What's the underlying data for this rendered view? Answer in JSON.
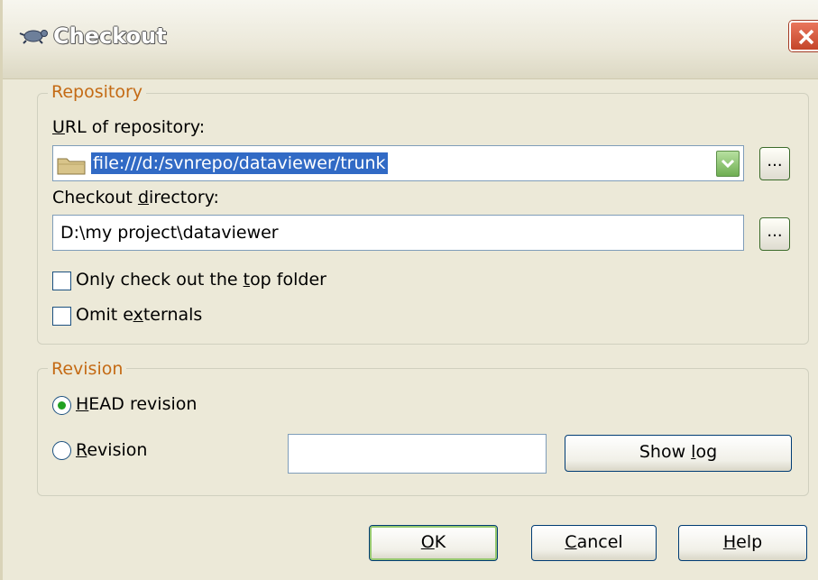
{
  "window": {
    "title": "Checkout"
  },
  "repository": {
    "legend": "Repository",
    "url_label_accel": "U",
    "url_label_rest": "RL of repository:",
    "url_value": "file:///d:/svnrepo/dataviewer/trunk",
    "browse_label": "...",
    "dir_label_pre": "Checkout ",
    "dir_label_accel": "d",
    "dir_label_post": "irectory:",
    "dir_value": "D:\\my project\\dataviewer",
    "top_folder_pre": "Only check out the ",
    "top_folder_accel": "t",
    "top_folder_post": "op folder",
    "top_folder_checked": false,
    "omit_pre": "Omit e",
    "omit_accel": "x",
    "omit_post": "ternals",
    "omit_checked": false
  },
  "revision": {
    "legend": "Revision",
    "head_accel": "H",
    "head_rest": "EAD revision",
    "head_selected": true,
    "rev_accel": "R",
    "rev_rest": "evision",
    "rev_selected": false,
    "rev_value": "",
    "show_log_pre": "Show ",
    "show_log_accel": "l",
    "show_log_post": "og"
  },
  "buttons": {
    "ok_accel": "O",
    "ok_rest": "K",
    "cancel_accel": "C",
    "cancel_rest": "ancel",
    "help_accel": "H",
    "help_rest": "elp"
  },
  "colors": {
    "accent_legend": "#c46a14",
    "selection": "#316ac5",
    "close": "#c4452a"
  }
}
